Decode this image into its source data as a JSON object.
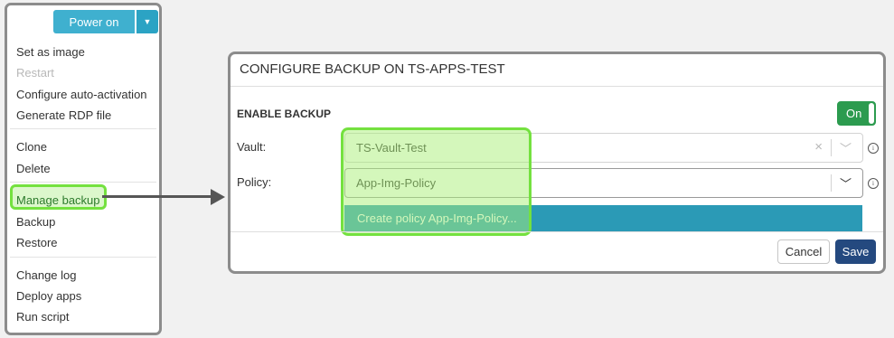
{
  "menu": {
    "power_on_label": "Power on",
    "caret_icon": "caret-down-icon",
    "items": [
      {
        "label": "Set as image",
        "disabled": false
      },
      {
        "label": "Restart",
        "disabled": true
      },
      {
        "label": "Configure auto-activation",
        "disabled": false
      },
      {
        "label": "Generate RDP file",
        "disabled": false
      },
      {
        "label": "Clone",
        "disabled": false
      },
      {
        "label": "Delete",
        "disabled": false
      },
      {
        "label": "Manage backup",
        "disabled": false,
        "highlighted": true
      },
      {
        "label": "Backup",
        "disabled": false
      },
      {
        "label": "Restore",
        "disabled": false
      },
      {
        "label": "Change log",
        "disabled": false
      },
      {
        "label": "Deploy apps",
        "disabled": false
      },
      {
        "label": "Run script",
        "disabled": false
      }
    ]
  },
  "dialog": {
    "title": "CONFIGURE BACKUP ON TS-APPS-TEST",
    "enable_backup_label": "ENABLE BACKUP",
    "toggle_label": "On",
    "vault": {
      "label": "Vault:",
      "value": "TS-Vault-Test"
    },
    "policy": {
      "label": "Policy:",
      "value": "App-Img-Policy"
    },
    "dropdown_option": "Create policy App-Img-Policy...",
    "cancel_label": "Cancel",
    "save_label": "Save"
  },
  "colors": {
    "accent": "#3fb0cf",
    "highlight": "#74e13f",
    "toggle_on": "#2c9b4f",
    "save": "#24497f",
    "dropdown_option": "#2b9ab6"
  }
}
